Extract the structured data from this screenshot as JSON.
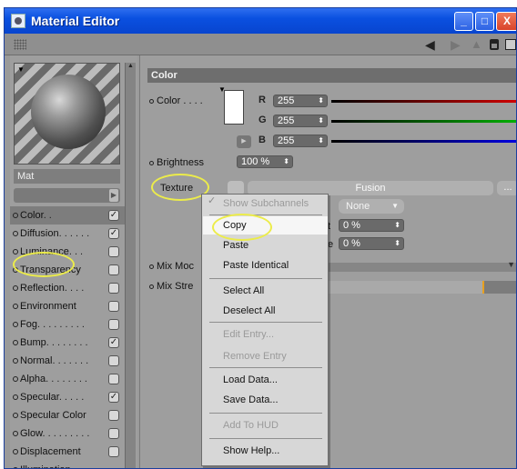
{
  "window": {
    "title": "Material Editor",
    "min_btn": "_",
    "max_btn": "□",
    "close_btn": "X"
  },
  "toolbar": {
    "nav_left": "◀",
    "nav_right": "▶",
    "nav_up": "▲"
  },
  "material": {
    "name": "Mat"
  },
  "channels": [
    {
      "label": "Color",
      "dots": ". .",
      "checked": true
    },
    {
      "label": "Diffusion",
      "dots": ". . . . . .",
      "checked": true
    },
    {
      "label": "Luminance",
      "dots": ". . .",
      "checked": false
    },
    {
      "label": "Transparency",
      "dots": "",
      "checked": false
    },
    {
      "label": "Reflection",
      "dots": ". . . .",
      "checked": false
    },
    {
      "label": "Environment",
      "dots": "",
      "checked": false
    },
    {
      "label": "Fog",
      "dots": ". . . . . . . . .",
      "checked": false
    },
    {
      "label": "Bump",
      "dots": ". . . . . . . .",
      "checked": true
    },
    {
      "label": "Normal",
      "dots": ". . . . . . .",
      "checked": false
    },
    {
      "label": "Alpha",
      "dots": ". . . . . . . .",
      "checked": false
    },
    {
      "label": "Specular",
      "dots": ". . . . .",
      "checked": true
    },
    {
      "label": "Specular Color",
      "dots": "",
      "checked": false
    },
    {
      "label": "Glow",
      "dots": ". . . . . . . . .",
      "checked": false
    },
    {
      "label": "Displacement",
      "dots": "",
      "checked": false
    },
    {
      "label": "Illumination",
      "dots": "",
      "checked": false
    }
  ],
  "color_section": {
    "header": "Color",
    "color_label": "Color . . . .",
    "r_label": "R",
    "r_value": "255",
    "g_label": "G",
    "g_value": "255",
    "b_label": "B",
    "b_value": "255",
    "brightness_label": "Brightness",
    "brightness_value": "100 %",
    "texture_label": "Texture",
    "fusion_label": "Fusion",
    "more_label": "...",
    "none_label": "None",
    "percent_1": "0 %",
    "percent_2": "0 %",
    "frag_t": "t",
    "frag_e": "e",
    "mix_mode_label": "Mix Moc",
    "mix_strength_label": "Mix Stre"
  },
  "context_menu": {
    "items": [
      {
        "label": "Show Subchannels",
        "disabled": true,
        "checked": true
      },
      {
        "label": "Copy",
        "disabled": false
      },
      {
        "label": "Paste",
        "disabled": false
      },
      {
        "label": "Paste Identical",
        "disabled": false
      },
      {
        "label": "Select All",
        "disabled": false
      },
      {
        "label": "Deselect All",
        "disabled": false
      },
      {
        "label": "Edit Entry...",
        "disabled": true
      },
      {
        "label": "Remove Entry",
        "disabled": true
      },
      {
        "label": "Load Data...",
        "disabled": false
      },
      {
        "label": "Save Data...",
        "disabled": false
      },
      {
        "label": "Add To HUD",
        "disabled": true
      },
      {
        "label": "Show Help...",
        "disabled": false
      }
    ]
  },
  "colors": {
    "titlebar": "#0a50e0",
    "highlight_circle": "#ecec4a",
    "panel": "#9e9e9e"
  }
}
